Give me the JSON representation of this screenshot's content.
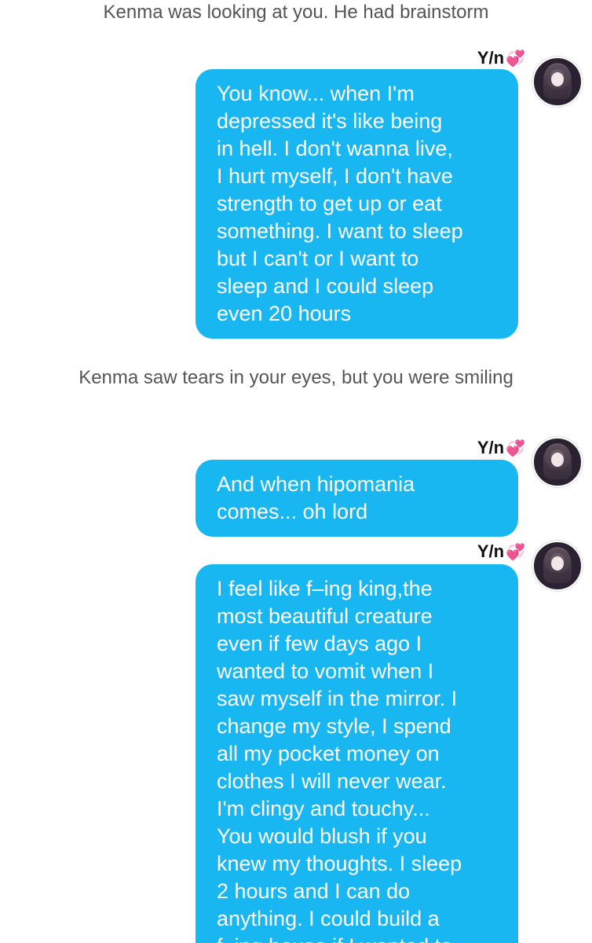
{
  "narration": [
    "Kenma was looking at you. He had brainstorm",
    "Kenma saw tears in your eyes, but you were smiling"
  ],
  "messages": [
    {
      "sender": "Y/n",
      "heart_icon": "two-hearts-icon",
      "text": "You know... when I'm\ndepressed it's like being\nin hell. I don't wanna live,\nI hurt myself, I don't have\nstrength to get up or eat\nsomething. I want to sleep\nbut I can't or I want to\nsleep and I could sleep\neven 20 hours"
    },
    {
      "sender": "Y/n",
      "heart_icon": "two-hearts-icon",
      "text": "And when hipomania\ncomes... oh lord"
    },
    {
      "sender": "Y/n",
      "heart_icon": "two-hearts-icon",
      "text": "I feel like f–ing king,the\nmost beautiful creature\neven if few days ago I\nwanted to vomit when I\nsaw myself in the mirror. I\nchange my style, I spend\nall my pocket money on\nclothes I will never wear.\nI'm clingy and touchy...\nYou would blush if you\nknew my thoughts. I sleep\n2 hours and I can do\nanything. I could build a\nf–ing house if I wanted to"
    }
  ],
  "colors": {
    "bubble": "#19b7f1",
    "narration": "#555555",
    "heart": "#ff3b8d"
  }
}
